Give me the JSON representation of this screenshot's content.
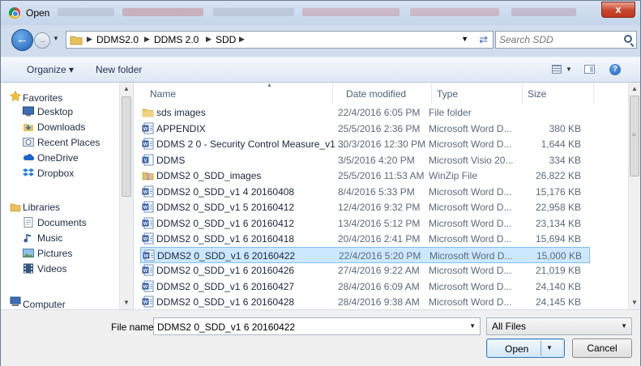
{
  "window": {
    "title": "Open",
    "close_glyph": "x"
  },
  "address": {
    "crumbs": [
      "DDMS2.0",
      "DDMS 2.0",
      "SDD"
    ],
    "search_placeholder": "Search SDD"
  },
  "toolbar": {
    "organize_label": "Organize ▾",
    "new_folder_label": "New folder",
    "help_glyph": "?"
  },
  "nav": {
    "favorites_label": "Favorites",
    "favorites": [
      "Desktop",
      "Downloads",
      "Recent Places",
      "OneDrive",
      "Dropbox"
    ],
    "libraries_label": "Libraries",
    "libraries": [
      "Documents",
      "Music",
      "Pictures",
      "Videos"
    ],
    "computer_label": "Computer"
  },
  "columns": {
    "name": "Name",
    "date": "Date modified",
    "type": "Type",
    "size": "Size"
  },
  "files": [
    {
      "name": "sds images",
      "date": "22/4/2016 6:05 PM",
      "type": "File folder",
      "size": "",
      "icon": "folder-icon"
    },
    {
      "name": "APPENDIX",
      "date": "25/5/2016 2:36 PM",
      "type": "Microsoft Word D...",
      "size": "380 KB",
      "icon": "word-doc-icon"
    },
    {
      "name": "DDMS 2 0 - Security Control Measure_v1 ...",
      "date": "30/3/2016 12:30 PM",
      "type": "Microsoft Word D...",
      "size": "1,644 KB",
      "icon": "word-doc-icon"
    },
    {
      "name": "DDMS",
      "date": "3/5/2016 4:20 PM",
      "type": "Microsoft Visio 20...",
      "size": "334 KB",
      "icon": "visio-doc-icon"
    },
    {
      "name": "DDMS2 0_SDD_images",
      "date": "25/5/2016 11:53 AM",
      "type": "WinZip File",
      "size": "26,822 KB",
      "icon": "zip-file-icon"
    },
    {
      "name": "DDMS2 0_SDD_v1 4 20160408",
      "date": "8/4/2016 5:33 PM",
      "type": "Microsoft Word D...",
      "size": "15,176 KB",
      "icon": "word-doc-icon"
    },
    {
      "name": "DDMS2 0_SDD_v1 5 20160412",
      "date": "12/4/2016 9:32 PM",
      "type": "Microsoft Word D...",
      "size": "22,958 KB",
      "icon": "word-doc-icon"
    },
    {
      "name": "DDMS2 0_SDD_v1 6 20160412",
      "date": "13/4/2016 5:12 PM",
      "type": "Microsoft Word D...",
      "size": "23,134 KB",
      "icon": "word-doc-icon"
    },
    {
      "name": "DDMS2 0_SDD_v1 6 20160418",
      "date": "20/4/2016 2:41 PM",
      "type": "Microsoft Word D...",
      "size": "15,694 KB",
      "icon": "word-doc-icon"
    },
    {
      "name": "DDMS2 0_SDD_v1 6 20160422",
      "date": "22/4/2016 5:20 PM",
      "type": "Microsoft Word D...",
      "size": "15,000 KB",
      "icon": "word-doc-icon",
      "selected": true
    },
    {
      "name": "DDMS2 0_SDD_v1 6 20160426",
      "date": "27/4/2016 9:22 AM",
      "type": "Microsoft Word D...",
      "size": "21,019 KB",
      "icon": "word-doc-icon"
    },
    {
      "name": "DDMS2 0_SDD_v1 6 20160427",
      "date": "28/4/2016 6:09 AM",
      "type": "Microsoft Word D...",
      "size": "24,140 KB",
      "icon": "word-doc-icon"
    },
    {
      "name": "DDMS2 0_SDD_v1 6 20160428",
      "date": "28/4/2016 9:38 AM",
      "type": "Microsoft Word D...",
      "size": "24,145 KB",
      "icon": "word-doc-icon"
    }
  ],
  "footer": {
    "file_name_label": "File name:",
    "file_name_value": "DDMS2 0_SDD_v1 6 20160422",
    "filter_value": "All Files",
    "open_label": "Open",
    "cancel_label": "Cancel"
  },
  "colors": {
    "selection": "#cce8ff",
    "chrome": "#cfdded",
    "close": "#c8452c"
  }
}
